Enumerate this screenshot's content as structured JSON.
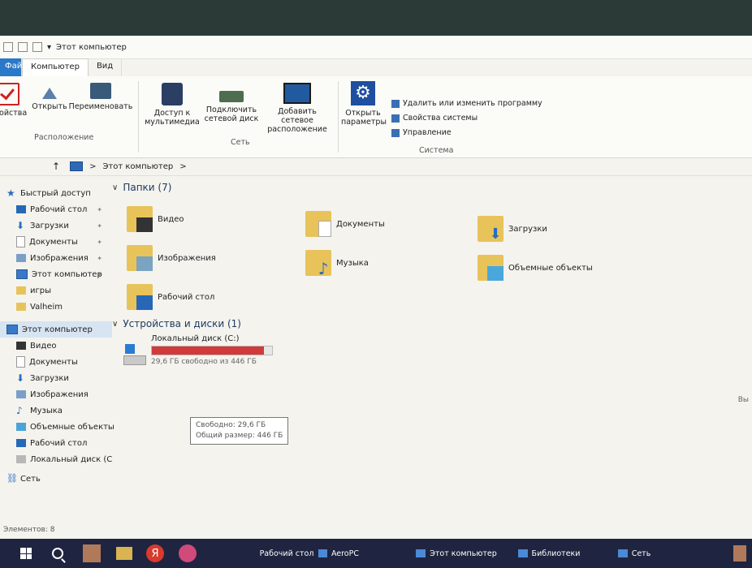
{
  "window": {
    "title": "Этот компьютер",
    "tabs": [
      "Файл",
      "Компьютер",
      "Вид"
    ]
  },
  "ribbon": {
    "location": {
      "buttons": [
        "Свойства",
        "Открыть",
        "Переименовать"
      ],
      "group_label": "Расположение"
    },
    "network": {
      "media_access": "Доступ к мультимедиа",
      "map_drive": "Подключить сетевой диск",
      "add_location": "Добавить сетевое расположение",
      "group_label": "Сеть"
    },
    "system": {
      "open_settings": "Открыть параметры",
      "items": [
        "Удалить или изменить программу",
        "Свойства системы",
        "Управление"
      ],
      "group_label": "Система"
    }
  },
  "address": {
    "path": "Этот компьютер",
    "separator": ">"
  },
  "sidebar": {
    "quick_access": "Быстрый доступ",
    "quick_items": [
      "Рабочий стол",
      "Загрузки",
      "Документы",
      "Изображения",
      "Этот компьютер",
      "игры",
      "Valheim"
    ],
    "this_pc": "Этот компьютер",
    "pc_items": [
      "Видео",
      "Документы",
      "Загрузки",
      "Изображения",
      "Музыка",
      "Объемные объекты",
      "Рабочий стол",
      "Локальный диск (C"
    ],
    "network": "Сеть"
  },
  "content": {
    "folders_header": "Папки (7)",
    "folders": [
      "Видео",
      "Документы",
      "Загрузки",
      "Изображения",
      "Музыка",
      "Объемные объекты",
      "Рабочий стол"
    ],
    "devices_header": "Устройства и диски (1)",
    "disk": {
      "name": "Локальный диск (C:)",
      "free_text": "29,6 ГБ свободно из 446 ГБ",
      "used_fraction": 0.934
    },
    "tooltip": {
      "free": "Свободно: 29,6 ГБ",
      "total": "Общий размер: 446 ГБ"
    },
    "right_cut": "Вы"
  },
  "status": {
    "items": "Элементов: 8"
  },
  "taskbar": {
    "tasks": [
      "Рабочий стол",
      "AeroPC",
      "Этот компьютер",
      "Библиотеки",
      "Сеть"
    ],
    "yandex_letter": "Я"
  }
}
